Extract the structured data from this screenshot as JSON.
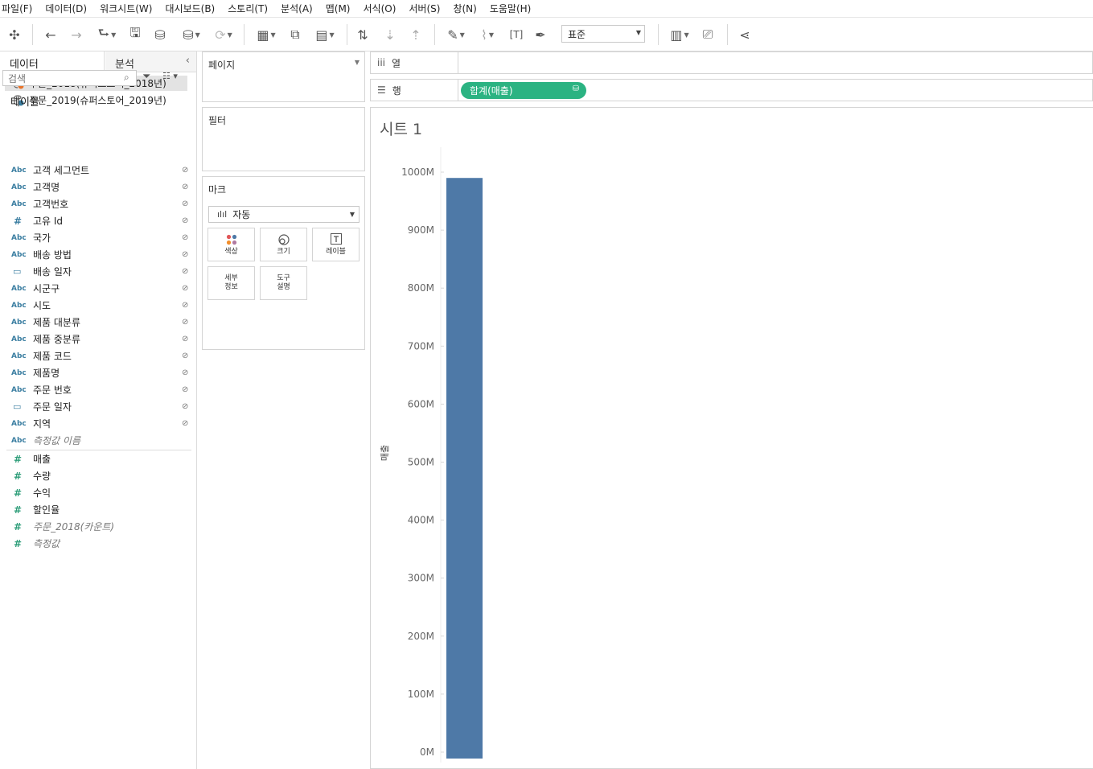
{
  "menu": [
    "파일(F)",
    "데이터(D)",
    "워크시트(W)",
    "대시보드(B)",
    "스토리(T)",
    "분석(A)",
    "맵(M)",
    "서식(O)",
    "서버(S)",
    "창(N)",
    "도움말(H)"
  ],
  "toolbar": {
    "fit_select": "표준"
  },
  "data_pane": {
    "tab_data": "데이터",
    "tab_analysis": "분석",
    "datasources": [
      {
        "label": "주문_2018(슈퍼스토어_2018년)"
      },
      {
        "label": "주문_2019(슈퍼스토어_2019년)"
      }
    ],
    "search_placeholder": "검색",
    "tables_header": "테이블",
    "dimensions": [
      {
        "type": "Abc",
        "name": "고객 세그먼트"
      },
      {
        "type": "Abc",
        "name": "고객명"
      },
      {
        "type": "Abc",
        "name": "고객번호"
      },
      {
        "type": "#",
        "name": "고유 Id"
      },
      {
        "type": "Abc",
        "name": "국가"
      },
      {
        "type": "Abc",
        "name": "배송 방법"
      },
      {
        "type": "date",
        "name": "배송 일자"
      },
      {
        "type": "Abc",
        "name": "시군구"
      },
      {
        "type": "Abc",
        "name": "시도"
      },
      {
        "type": "Abc",
        "name": "제품 대분류"
      },
      {
        "type": "Abc",
        "name": "제품 중분류"
      },
      {
        "type": "Abc",
        "name": "제품 코드"
      },
      {
        "type": "Abc",
        "name": "제품명"
      },
      {
        "type": "Abc",
        "name": "주문 번호"
      },
      {
        "type": "date",
        "name": "주문 일자"
      },
      {
        "type": "Abc",
        "name": "지역"
      },
      {
        "type": "Abc",
        "name": "측정값 이름"
      }
    ],
    "measures": [
      {
        "type": "#",
        "name": "매출"
      },
      {
        "type": "#",
        "name": "수량"
      },
      {
        "type": "#",
        "name": "수익"
      },
      {
        "type": "#",
        "name": "할인율"
      },
      {
        "type": "#",
        "name": "주문_2018(카운트)"
      },
      {
        "type": "#",
        "name": "측정값"
      }
    ]
  },
  "cards": {
    "pages": "페이지",
    "filters": "필터",
    "marks": "마크",
    "marks_type": "자동",
    "mark_buttons": {
      "color": "색상",
      "size": "크기",
      "label": "레이블",
      "detail": "세부\n정보",
      "tooltip": "도구\n설명"
    }
  },
  "shelves": {
    "columns_label": "열",
    "rows_label": "행",
    "rows_pill": "합계(매출)"
  },
  "sheet": {
    "title": "시트 1"
  },
  "chart_data": {
    "type": "bar",
    "categories": [
      ""
    ],
    "values": [
      990000000
    ],
    "ylabel": "매출",
    "xlabel": "",
    "ylim": [
      0,
      1000000000
    ],
    "yticks": [
      "0M",
      "100M",
      "200M",
      "300M",
      "400M",
      "500M",
      "600M",
      "700M",
      "800M",
      "900M",
      "1000M"
    ],
    "bar_color": "#4e79a7",
    "grid": false
  }
}
